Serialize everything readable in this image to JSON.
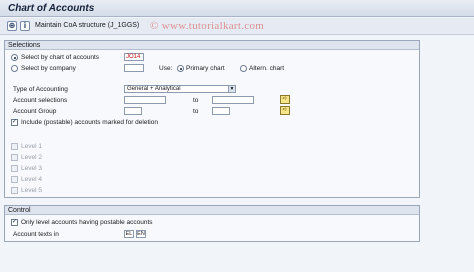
{
  "header": {
    "title": "Chart of Accounts"
  },
  "toolbar": {
    "text": "Maintain CoA structure (J_1GGS)"
  },
  "watermark": "© www.tutorialkart.com",
  "selections": {
    "heading": "Selections",
    "by_chart_label": "Select by chart of accounts",
    "by_chart_value": "JO14",
    "by_company_label": "Select by company",
    "by_company_value": "",
    "use_label": "Use:",
    "primary_chart_label": "Primary chart",
    "altern_chart_label": "Altern. chart",
    "type_label": "Type of Accounting",
    "type_value": "General + Analytical",
    "account_selections_label": "Account selections",
    "account_group_label": "Account Group",
    "to_label": "to",
    "include_label": "Include (postable) accounts marked for deletion",
    "levels": [
      "Level 1",
      "Level 2",
      "Level 3",
      "Level 4",
      "Level 5"
    ]
  },
  "control": {
    "heading": "Control",
    "only_level_label": "Only level accounts having postable accounts",
    "account_texts_label": "Account texts in",
    "lang1": "EL",
    "lang2": "EN"
  }
}
